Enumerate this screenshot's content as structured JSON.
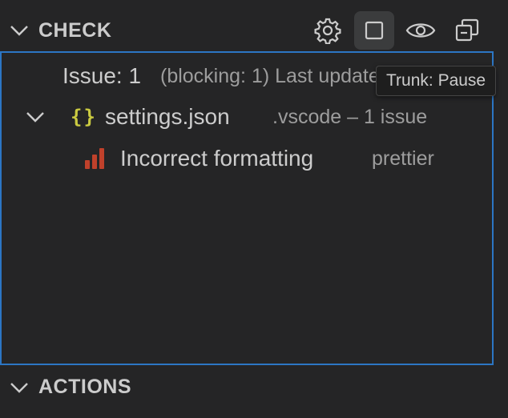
{
  "check_section": {
    "title": "CHECK",
    "toolbar": {
      "settings_icon": "gear-icon",
      "pause_icon": "square-stop-icon",
      "view_icon": "eye-icon",
      "collapse_icon": "collapse-all-icon"
    },
    "summary": {
      "label": "Issue: 1",
      "detail": "(blocking: 1) Last updated"
    },
    "file": {
      "icon": "json-braces-icon",
      "icon_text": "{}",
      "name": "settings.json",
      "description": ".vscode – 1 issue"
    },
    "issue": {
      "icon": "severity-bars-icon",
      "title": "Incorrect formatting",
      "source": "prettier"
    },
    "tooltip": "Trunk: Pause"
  },
  "actions_section": {
    "title": "ACTIONS"
  },
  "colors": {
    "background": "#252526",
    "focus_border": "#2c76c4",
    "json_icon": "#cbcb41",
    "severity": "#c0412b",
    "foreground": "#cccccc",
    "muted": "#9d9d9d"
  }
}
